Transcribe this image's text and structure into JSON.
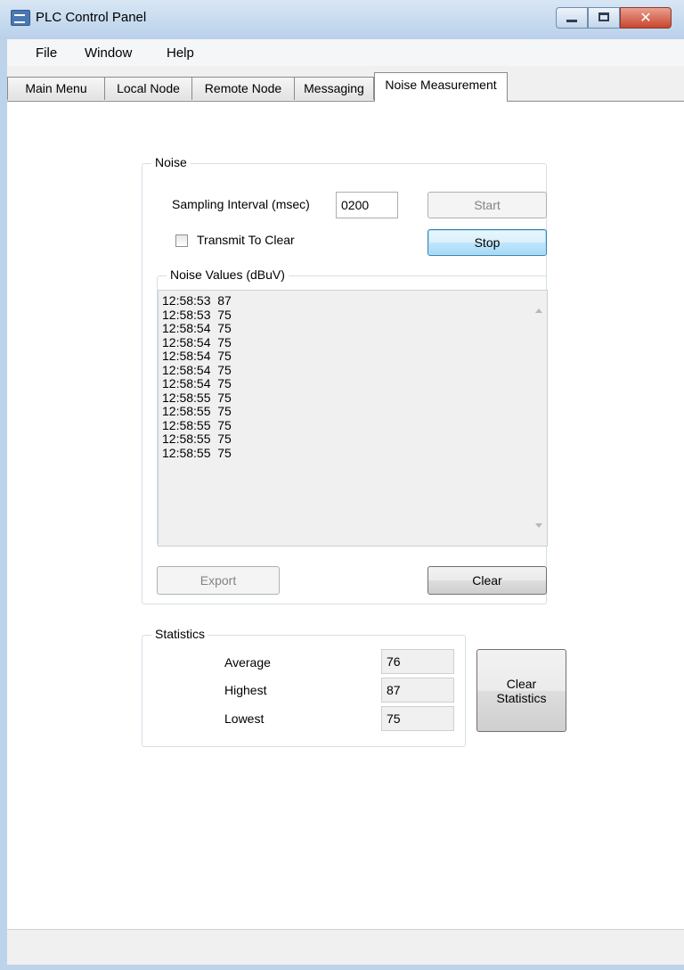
{
  "window": {
    "title": "PLC Control Panel",
    "minimize_icon": "minimize-icon",
    "maximize_icon": "maximize-icon",
    "close_icon": "close-icon",
    "close_glyph": "✕"
  },
  "menu": [
    "File",
    "Window",
    "Help"
  ],
  "tabs": [
    {
      "label": "Main Menu",
      "active": false
    },
    {
      "label": "Local Node",
      "active": false
    },
    {
      "label": "Remote Node",
      "active": false
    },
    {
      "label": "Messaging",
      "active": false
    },
    {
      "label": "Noise Measurement",
      "active": true
    }
  ],
  "noise": {
    "group_label": "Noise",
    "sampling_label": "Sampling Interval (msec)",
    "sampling_value": "0200",
    "start_label": "Start",
    "stop_label": "Stop",
    "transmit_label": "Transmit To Clear",
    "transmit_checked": false,
    "values_group_label": "Noise Values (dBuV)",
    "values": [
      "12:58:53  87",
      "12:58:53  75",
      "12:58:54  75",
      "12:58:54  75",
      "12:58:54  75",
      "12:58:54  75",
      "12:58:54  75",
      "12:58:55  75",
      "12:58:55  75",
      "12:58:55  75",
      "12:58:55  75",
      "12:58:55  75"
    ],
    "export_label": "Export",
    "clear_label": "Clear"
  },
  "statistics": {
    "group_label": "Statistics",
    "average_label": "Average",
    "average_value": "76",
    "highest_label": "Highest",
    "highest_value": "87",
    "lowest_label": "Lowest",
    "lowest_value": "75",
    "clear_label_line1": "Clear",
    "clear_label_line2": "Statistics"
  },
  "colors": {
    "window_frame": "#bcd3ea",
    "close_button": "#c8452f",
    "focused_button": "#3c7fb1"
  }
}
